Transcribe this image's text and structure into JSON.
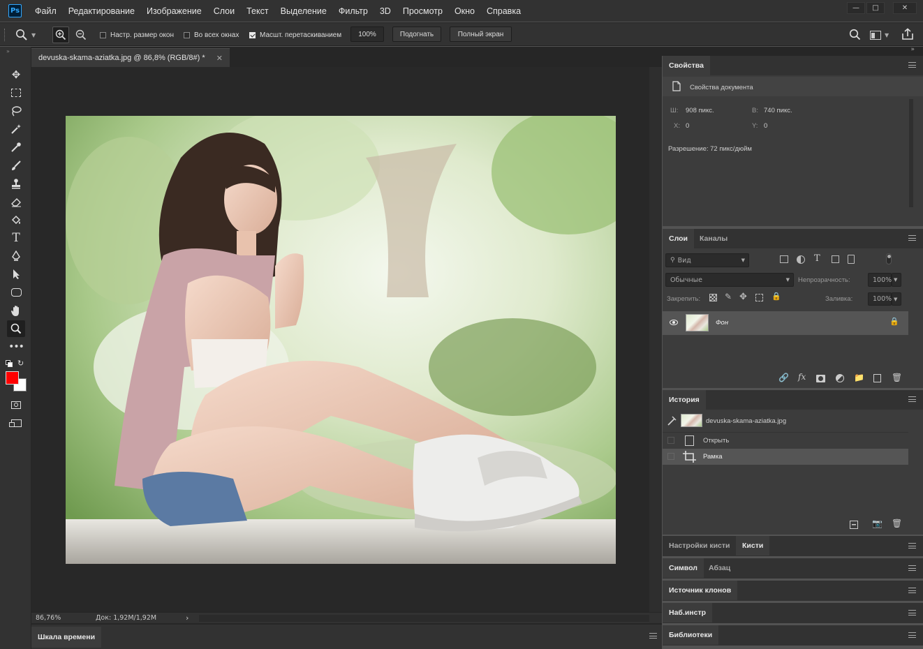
{
  "app": {
    "logo": "Ps"
  },
  "menu": [
    "Файл",
    "Редактирование",
    "Изображение",
    "Слои",
    "Текст",
    "Выделение",
    "Фильтр",
    "3D",
    "Просмотр",
    "Окно",
    "Справка"
  ],
  "options": {
    "resize_windows": "Настр. размер окон",
    "all_windows": "Во всех окнах",
    "scrubby_zoom": "Масшт. перетаскиванием",
    "zoom_value": "100%",
    "fit_btn": "Подогнать",
    "fullscreen_btn": "Полный экран"
  },
  "document": {
    "tab_title": "devuska-skama-aziatka.jpg @ 86,8% (RGB/8#) *"
  },
  "status": {
    "zoom": "86,76%",
    "doc": "Док: 1,92M/1,92M"
  },
  "timeline": {
    "label": "Шкала времени"
  },
  "properties": {
    "tab": "Свойства",
    "doc_props": "Свойства документа",
    "w_label": "Ш:",
    "w_value": "908 пикс.",
    "h_label": "В:",
    "h_value": "740 пикс.",
    "x_label": "X:",
    "x_value": "0",
    "y_label": "Y:",
    "y_value": "0",
    "resolution": "Разрешение: 72 пикс/дюйм"
  },
  "layers": {
    "tab_layers": "Слои",
    "tab_channels": "Каналы",
    "filter_placeholder": "Вид",
    "blend": "Обычные",
    "opacity_label": "Непрозрачность:",
    "opacity_value": "100%",
    "lock_label": "Закрепить:",
    "fill_label": "Заливка:",
    "fill_value": "100%",
    "items": [
      {
        "name": "Фон"
      }
    ]
  },
  "history": {
    "tab": "История",
    "snapshot": "devuska-skama-aziatka.jpg",
    "items": [
      {
        "label": "Открыть"
      },
      {
        "label": "Рамка"
      }
    ]
  },
  "collapsed_panels": {
    "brush_settings": "Настройки кисти",
    "brushes": "Кисти",
    "character": "Символ",
    "paragraph": "Абзац",
    "clone_source": "Источник клонов",
    "tool_presets": "Наб.инстр",
    "libraries": "Библиотеки"
  },
  "colors": {
    "foreground": "#ff0000",
    "background": "#ffffff",
    "accent": "#31a8ff"
  }
}
